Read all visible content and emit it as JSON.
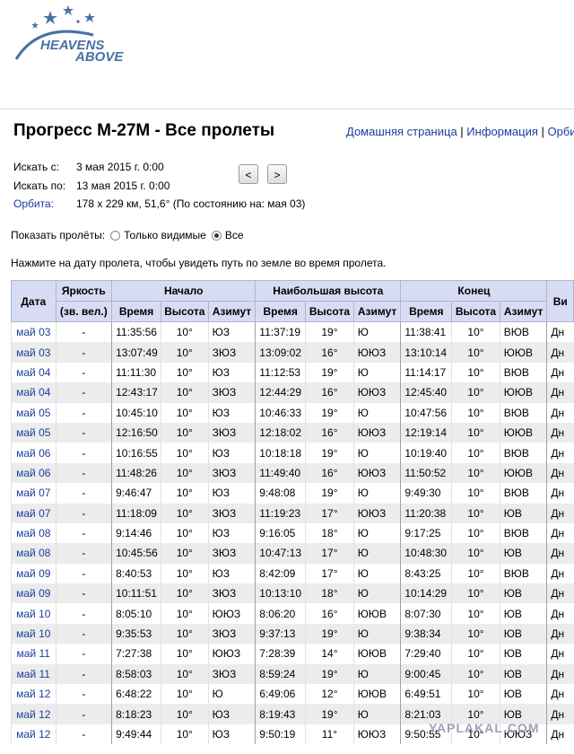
{
  "logo": {
    "line1": "HEAVENS",
    "line2": "ABOVE"
  },
  "title": "Прогресс М-27М - Все пролеты",
  "links": [
    "Домашняя страница",
    "Информация",
    "Орбиты"
  ],
  "search": {
    "from_label": "Искать с:",
    "from_value": "3 мая 2015 г. 0:00",
    "to_label": "Искать по:",
    "to_value": "13 мая 2015 г. 0:00",
    "orbit_label": "Орбита:",
    "orbit_value": "178 x 229 км, 51,6° (По состоянию на: мая 03)",
    "prev": "<",
    "next": ">"
  },
  "filter": {
    "label": "Показать пролёты:",
    "option1": "Только видимые",
    "option2": "Все",
    "selected": "Все"
  },
  "hint": "Нажмите на дату пролета, чтобы увидеть путь по земле во время пролета.",
  "table": {
    "h_date": "Дата",
    "h_brightness": "Яркость",
    "h_brightness_sub": "(зв. вел.)",
    "h_start": "Начало",
    "h_max": "Наибольшая высота",
    "h_end": "Конец",
    "h_extra": "Ви",
    "h_time": "Время",
    "h_alt": "Высота",
    "h_az": "Азимут",
    "rows": [
      [
        "май 03",
        "-",
        "11:35:56",
        "10°",
        "ЮЗ",
        "11:37:19",
        "19°",
        "Ю",
        "11:38:41",
        "10°",
        "ВЮВ",
        "Дн"
      ],
      [
        "май 03",
        "-",
        "13:07:49",
        "10°",
        "ЗЮЗ",
        "13:09:02",
        "16°",
        "ЮЮЗ",
        "13:10:14",
        "10°",
        "ЮЮВ",
        "Дн"
      ],
      [
        "май 04",
        "-",
        "11:11:30",
        "10°",
        "ЮЗ",
        "11:12:53",
        "19°",
        "Ю",
        "11:14:17",
        "10°",
        "ВЮВ",
        "Дн"
      ],
      [
        "май 04",
        "-",
        "12:43:17",
        "10°",
        "ЗЮЗ",
        "12:44:29",
        "16°",
        "ЮЮЗ",
        "12:45:40",
        "10°",
        "ЮЮВ",
        "Дн"
      ],
      [
        "май 05",
        "-",
        "10:45:10",
        "10°",
        "ЮЗ",
        "10:46:33",
        "19°",
        "Ю",
        "10:47:56",
        "10°",
        "ВЮВ",
        "Дн"
      ],
      [
        "май 05",
        "-",
        "12:16:50",
        "10°",
        "ЗЮЗ",
        "12:18:02",
        "16°",
        "ЮЮЗ",
        "12:19:14",
        "10°",
        "ЮЮВ",
        "Дн"
      ],
      [
        "май 06",
        "-",
        "10:16:55",
        "10°",
        "ЮЗ",
        "10:18:18",
        "19°",
        "Ю",
        "10:19:40",
        "10°",
        "ВЮВ",
        "Дн"
      ],
      [
        "май 06",
        "-",
        "11:48:26",
        "10°",
        "ЗЮЗ",
        "11:49:40",
        "16°",
        "ЮЮЗ",
        "11:50:52",
        "10°",
        "ЮЮВ",
        "Дн"
      ],
      [
        "май 07",
        "-",
        "9:46:47",
        "10°",
        "ЮЗ",
        "9:48:08",
        "19°",
        "Ю",
        "9:49:30",
        "10°",
        "ВЮВ",
        "Дн"
      ],
      [
        "май 07",
        "-",
        "11:18:09",
        "10°",
        "ЗЮЗ",
        "11:19:23",
        "17°",
        "ЮЮЗ",
        "11:20:38",
        "10°",
        "ЮВ",
        "Дн"
      ],
      [
        "май 08",
        "-",
        "9:14:46",
        "10°",
        "ЮЗ",
        "9:16:05",
        "18°",
        "Ю",
        "9:17:25",
        "10°",
        "ВЮВ",
        "Дн"
      ],
      [
        "май 08",
        "-",
        "10:45:56",
        "10°",
        "ЗЮЗ",
        "10:47:13",
        "17°",
        "Ю",
        "10:48:30",
        "10°",
        "ЮВ",
        "Дн"
      ],
      [
        "май 09",
        "-",
        "8:40:53",
        "10°",
        "ЮЗ",
        "8:42:09",
        "17°",
        "Ю",
        "8:43:25",
        "10°",
        "ВЮВ",
        "Дн"
      ],
      [
        "май 09",
        "-",
        "10:11:51",
        "10°",
        "ЗЮЗ",
        "10:13:10",
        "18°",
        "Ю",
        "10:14:29",
        "10°",
        "ЮВ",
        "Дн"
      ],
      [
        "май 10",
        "-",
        "8:05:10",
        "10°",
        "ЮЮЗ",
        "8:06:20",
        "16°",
        "ЮЮВ",
        "8:07:30",
        "10°",
        "ЮВ",
        "Дн"
      ],
      [
        "май 10",
        "-",
        "9:35:53",
        "10°",
        "ЗЮЗ",
        "9:37:13",
        "19°",
        "Ю",
        "9:38:34",
        "10°",
        "ЮВ",
        "Дн"
      ],
      [
        "май 11",
        "-",
        "7:27:38",
        "10°",
        "ЮЮЗ",
        "7:28:39",
        "14°",
        "ЮЮВ",
        "7:29:40",
        "10°",
        "ЮВ",
        "Дн"
      ],
      [
        "май 11",
        "-",
        "8:58:03",
        "10°",
        "ЗЮЗ",
        "8:59:24",
        "19°",
        "Ю",
        "9:00:45",
        "10°",
        "ЮВ",
        "Дн"
      ],
      [
        "май 12",
        "-",
        "6:48:22",
        "10°",
        "Ю",
        "6:49:06",
        "12°",
        "ЮЮВ",
        "6:49:51",
        "10°",
        "ЮВ",
        "Дн"
      ],
      [
        "май 12",
        "-",
        "8:18:23",
        "10°",
        "ЮЗ",
        "8:19:43",
        "19°",
        "Ю",
        "8:21:03",
        "10°",
        "ЮВ",
        "Дн"
      ],
      [
        "май 12",
        "-",
        "9:49:44",
        "10°",
        "ЮЗ",
        "9:50:19",
        "11°",
        "ЮЮЗ",
        "9:50:55",
        "10°",
        "ЮЮЗ",
        "Дн"
      ]
    ]
  },
  "watermark": "YAPLAKAL.COM",
  "colors": {
    "link": "#1a3d9e",
    "header_bg": "#d7dcf4",
    "row_alt": "#ececec",
    "logo": "#4a6fa5"
  }
}
